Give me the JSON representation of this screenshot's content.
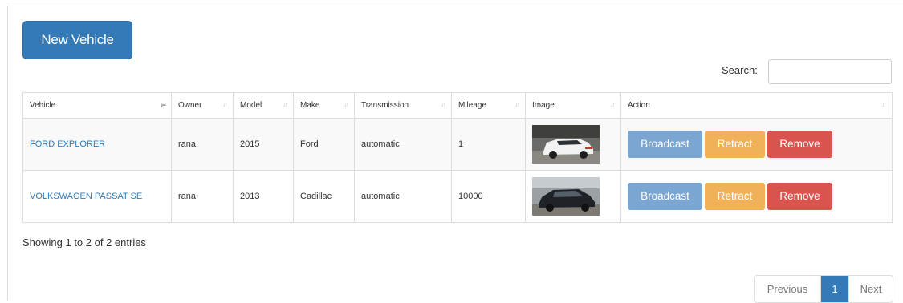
{
  "toolbar": {
    "new_vehicle_label": "New Vehicle"
  },
  "search": {
    "label": "Search:",
    "value": "",
    "placeholder": ""
  },
  "table": {
    "headers": [
      "Vehicle",
      "Owner",
      "Model",
      "Make",
      "Transmission",
      "Mileage",
      "Image",
      "Action"
    ],
    "rows": [
      {
        "vehicle": "FORD EXPLORER",
        "owner": "rana",
        "model": "2015",
        "make": "Ford",
        "transmission": "automatic",
        "mileage": "1",
        "image": "white-suv-photo"
      },
      {
        "vehicle": "VOLKSWAGEN PASSAT SE",
        "owner": "rana",
        "model": "2013",
        "make": "Cadillac",
        "transmission": "automatic",
        "mileage": "10000",
        "image": "dark-sedan-photo"
      }
    ],
    "action_labels": {
      "broadcast": "Broadcast",
      "retract": "Retract",
      "remove": "Remove"
    }
  },
  "footer": {
    "info": "Showing 1 to 2 of 2 entries",
    "pagination": {
      "previous": "Previous",
      "current": "1",
      "next": "Next"
    }
  },
  "colors": {
    "primary": "#337ab7",
    "broadcast": "#7ba6d1",
    "retract": "#f0b158",
    "remove": "#d9534f",
    "link": "#337ab7"
  },
  "icons": {
    "sort_both": "sort-both-icon",
    "sort_asc": "sort-ascending-icon"
  }
}
